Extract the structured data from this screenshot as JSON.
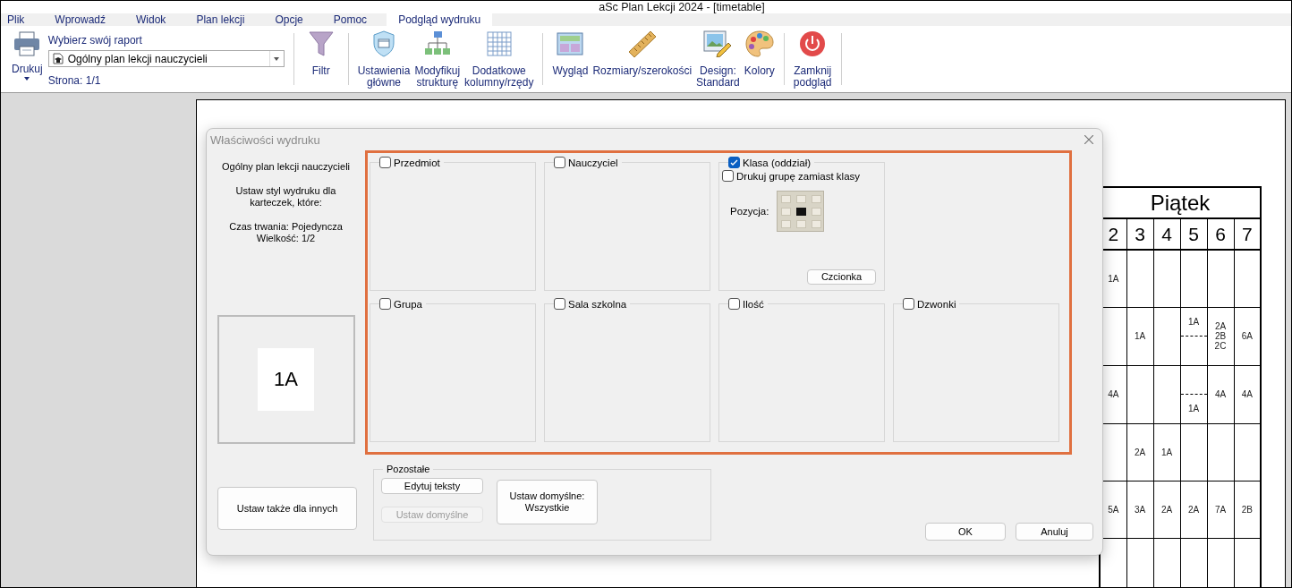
{
  "window": {
    "title": "aSc Plan Lekcji 2024  - [timetable]"
  },
  "menu_tabs": [
    {
      "label": "Plik",
      "selected": false
    },
    {
      "label": "Wprowadź",
      "selected": false
    },
    {
      "label": "Widok",
      "selected": false
    },
    {
      "label": "Plan lekcji",
      "selected": false
    },
    {
      "label": "Opcje",
      "selected": false
    },
    {
      "label": "Pomoc",
      "selected": false
    },
    {
      "label": "Podgląd wydruku",
      "selected": true
    }
  ],
  "ribbon": {
    "print_button": "Drukuj",
    "report": {
      "label": "Wybierz swój raport",
      "value": "Ogólny plan lekcji nauczycieli",
      "page": "Strona: 1/1"
    },
    "groups": [
      {
        "buttons": [
          {
            "label": "Filtr",
            "kind": "filter"
          }
        ]
      },
      {
        "buttons": [
          {
            "label": "Ustawienia\ngłówne",
            "kind": "settings"
          },
          {
            "label": "Modyfikuj\nstrukturę",
            "kind": "structure"
          },
          {
            "label": "Dodatkowe\nkolumny/rzędy",
            "kind": "columns"
          }
        ]
      },
      {
        "buttons": [
          {
            "label": "Wygląd",
            "kind": "look"
          },
          {
            "label": "Rozmiary/szerokości",
            "kind": "sizes"
          },
          {
            "label": "Design:\nStandard",
            "kind": "design"
          },
          {
            "label": "Kolory",
            "kind": "colors"
          }
        ]
      },
      {
        "buttons": [
          {
            "label": "Zamknij\npodgląd",
            "kind": "close"
          }
        ]
      }
    ]
  },
  "timetable": {
    "day": "Piątek",
    "periods": [
      "2",
      "3",
      "4",
      "5",
      "6",
      "7"
    ],
    "rows": [
      [
        {
          "kind": "single",
          "entries": [
            "1A"
          ]
        },
        {
          "kind": "empty"
        },
        {
          "kind": "empty"
        },
        {
          "kind": "empty"
        },
        {
          "kind": "empty"
        },
        {
          "kind": "empty"
        }
      ],
      [
        {
          "kind": "empty"
        },
        {
          "kind": "single",
          "entries": [
            "1A"
          ]
        },
        {
          "kind": "empty"
        },
        {
          "kind": "split",
          "top": "1A"
        },
        {
          "kind": "single",
          "entries": [
            "2A",
            "2B",
            "2C"
          ]
        },
        {
          "kind": "single",
          "entries": [
            "6A"
          ]
        }
      ],
      [
        {
          "kind": "single",
          "entries": [
            "4A"
          ]
        },
        {
          "kind": "empty"
        },
        {
          "kind": "empty"
        },
        {
          "kind": "split",
          "bottom": "1A"
        },
        {
          "kind": "single",
          "entries": [
            "4A"
          ]
        },
        {
          "kind": "single",
          "entries": [
            "4A"
          ]
        }
      ],
      [
        {
          "kind": "empty"
        },
        {
          "kind": "single",
          "entries": [
            "2A"
          ]
        },
        {
          "kind": "single",
          "entries": [
            "1A"
          ]
        },
        {
          "kind": "empty"
        },
        {
          "kind": "empty"
        },
        {
          "kind": "empty"
        }
      ],
      [
        {
          "kind": "single",
          "entries": [
            "5A"
          ]
        },
        {
          "kind": "single",
          "entries": [
            "3A"
          ]
        },
        {
          "kind": "single",
          "entries": [
            "2A"
          ]
        },
        {
          "kind": "single",
          "entries": [
            "2A"
          ]
        },
        {
          "kind": "single",
          "entries": [
            "7A"
          ]
        },
        {
          "kind": "single",
          "entries": [
            "2B"
          ]
        }
      ],
      [
        {
          "kind": "empty"
        },
        {
          "kind": "empty"
        },
        {
          "kind": "empty"
        },
        {
          "kind": "empty"
        },
        {
          "kind": "empty"
        },
        {
          "kind": "empty"
        }
      ]
    ]
  },
  "dialog": {
    "title": "Właściwości wydruku",
    "info": [
      "Ogólny plan lekcji nauczycieli",
      "Ustaw styl wydruku dla\nkarteczek, które:",
      "Czas trwania: Pojedyncza\nWielkość: 1/2"
    ],
    "preview_label": "1A",
    "apply_others": "Ustaw także dla innych",
    "field_rows": [
      [
        {
          "kind": "plain",
          "label": "Przedmiot",
          "checked": false
        },
        {
          "kind": "plain",
          "label": "Nauczyciel",
          "checked": false
        },
        {
          "kind": "class",
          "label": "Klasa (oddział)",
          "checked": true,
          "group_instead": {
            "label": "Drukuj grupę zamiast klasy",
            "checked": false
          },
          "position": {
            "label": "Pozycja:",
            "cells": [
              {
                "selected": false
              },
              {
                "selected": false
              },
              {
                "selected": false
              },
              {
                "selected": false
              },
              {
                "selected": true
              },
              {
                "selected": false
              },
              {
                "selected": false
              },
              {
                "selected": false
              },
              {
                "selected": false
              }
            ]
          },
          "font_button": "Czcionka"
        }
      ],
      [
        {
          "kind": "plain",
          "label": "Grupa",
          "checked": false
        },
        {
          "kind": "plain",
          "label": "Sala szkolna",
          "checked": false
        },
        {
          "kind": "plain",
          "label": "Ilość",
          "checked": false
        },
        {
          "kind": "plain",
          "label": "Dzwonki",
          "checked": false
        }
      ]
    ],
    "others": {
      "title": "Pozostałe",
      "buttons": [
        {
          "label": "Edytuj teksty",
          "disabled": false
        },
        {
          "label": "Ustaw domyślne",
          "disabled": true
        }
      ],
      "default_all": "Ustaw domyślne:\nWszystkie"
    },
    "ok": "OK",
    "cancel": "Anuluj"
  }
}
